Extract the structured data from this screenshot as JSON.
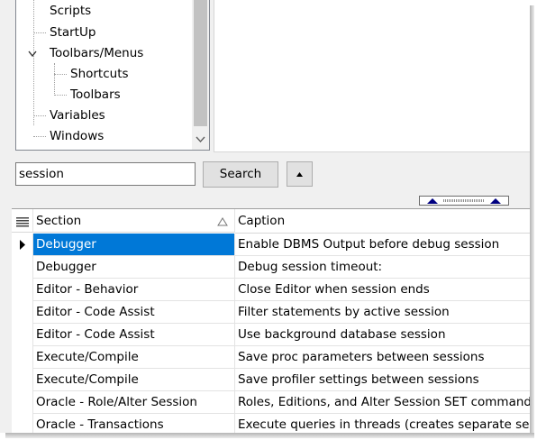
{
  "tree": {
    "items": [
      {
        "label": "Scripts"
      },
      {
        "label": "StartUp"
      },
      {
        "label": "Toolbars/Menus"
      },
      {
        "label": "Shortcuts"
      },
      {
        "label": "Toolbars"
      },
      {
        "label": "Variables"
      },
      {
        "label": "Windows"
      }
    ]
  },
  "search": {
    "value": "session",
    "button_label": "Search",
    "collapse_icon": "triangle-up-icon"
  },
  "grid": {
    "columns": [
      "Section",
      "Caption"
    ],
    "sort_icon": "sort-triangle-icon",
    "rows": [
      {
        "section": "Debugger",
        "caption": "Enable DBMS Output before debug session"
      },
      {
        "section": "Debugger",
        "caption": "Debug session timeout:"
      },
      {
        "section": "Editor - Behavior",
        "caption": "Close Editor when session ends"
      },
      {
        "section": "Editor - Code Assist",
        "caption": "Filter statements by active session"
      },
      {
        "section": "Editor - Code Assist",
        "caption": "Use background database session"
      },
      {
        "section": "Execute/Compile",
        "caption": "Save proc parameters between sessions"
      },
      {
        "section": "Execute/Compile",
        "caption": "Save profiler settings between sessions"
      },
      {
        "section": "Oracle - Role/Alter Session",
        "caption": "Roles, Editions, and Alter Session SET commands"
      },
      {
        "section": "Oracle - Transactions",
        "caption": "Execute queries in threads (creates separate session)"
      }
    ]
  },
  "colors": {
    "selection": "#0078d7",
    "splitter_arrow": "#000080"
  }
}
